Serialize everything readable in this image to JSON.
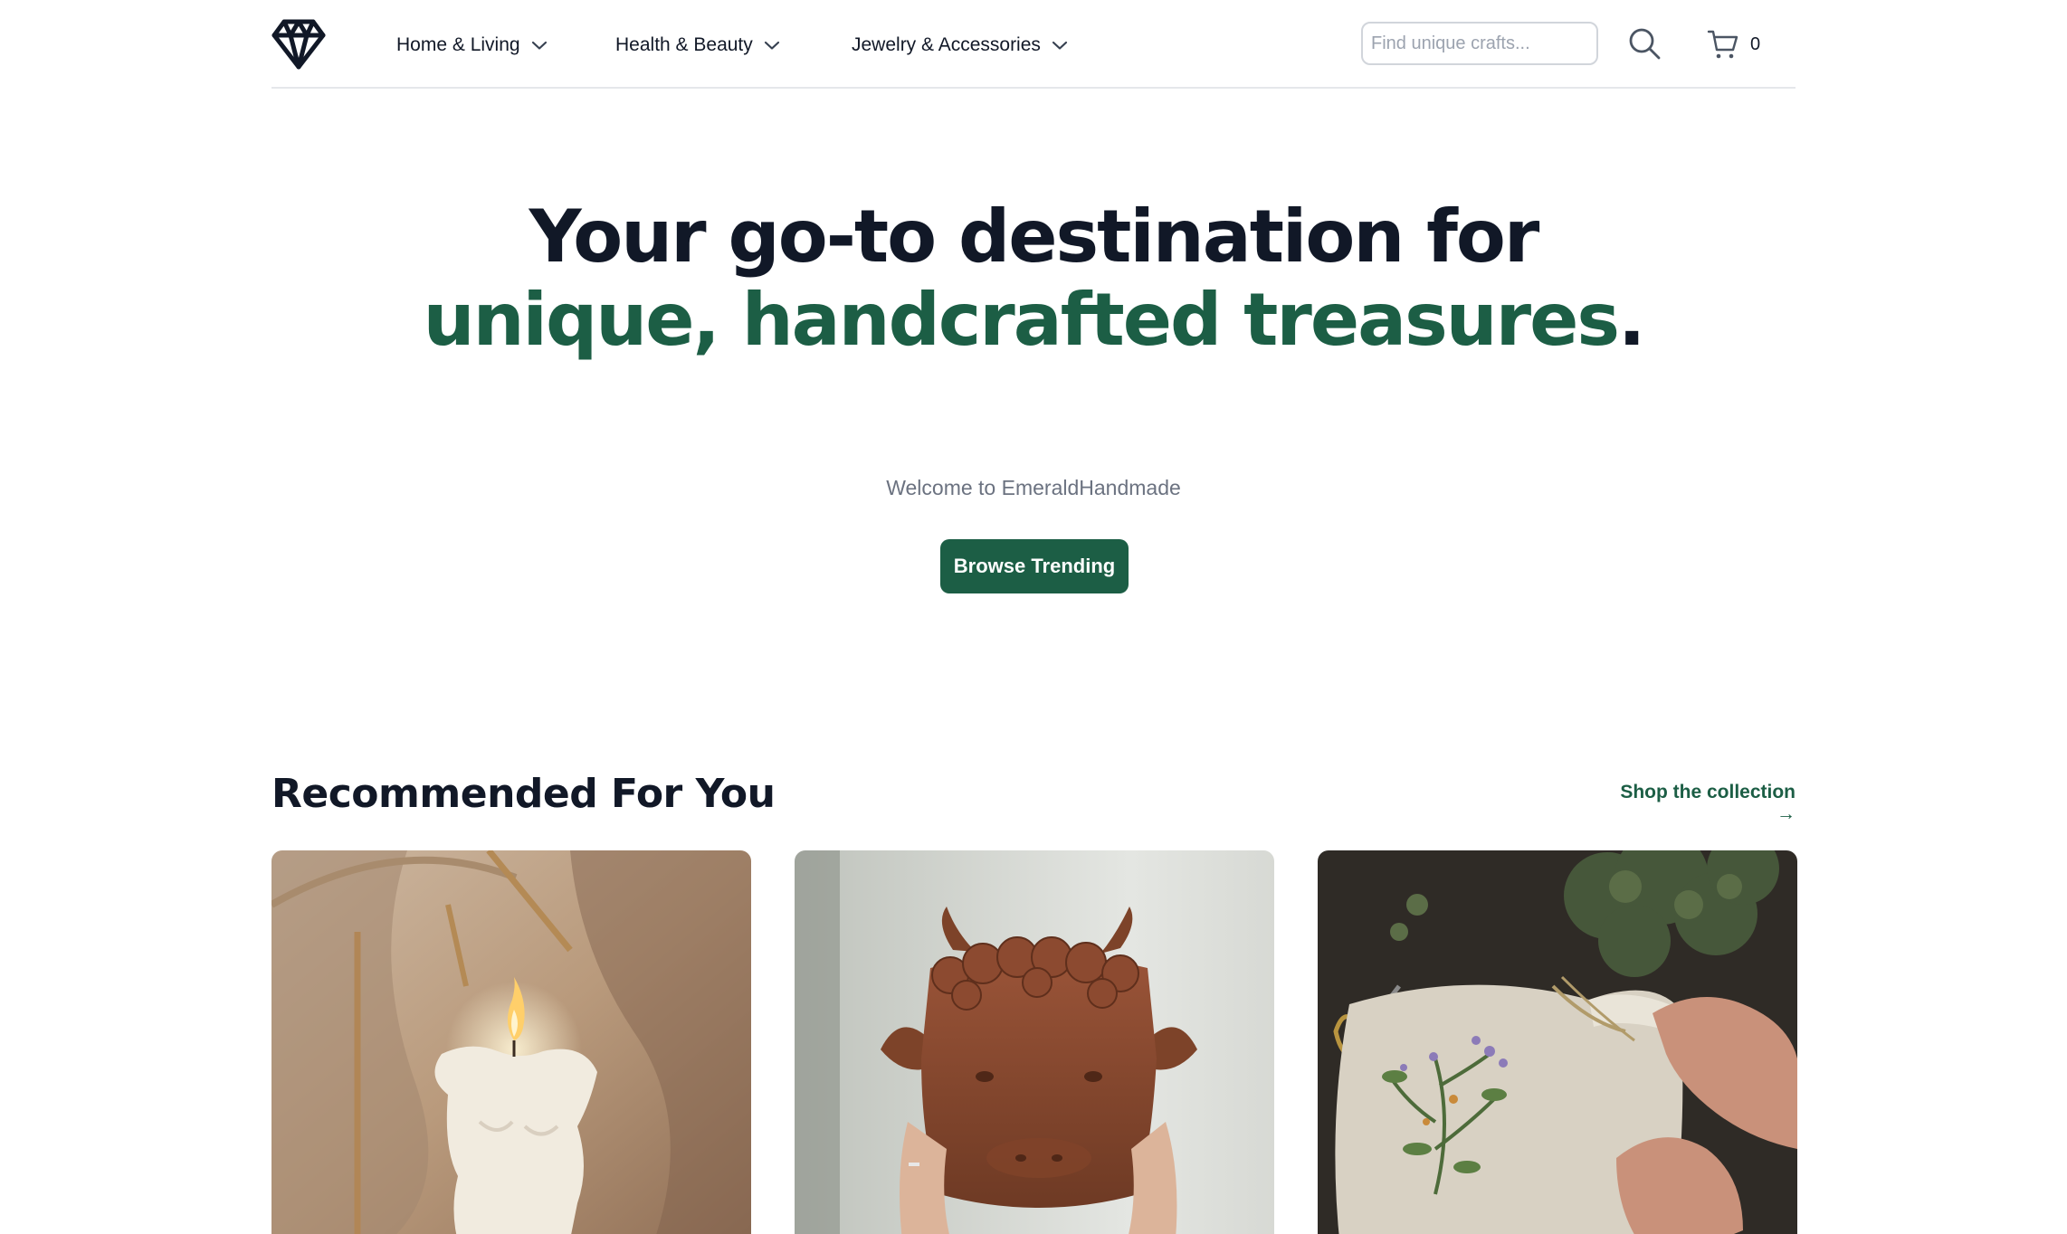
{
  "brand": {
    "logo": "diamond-icon"
  },
  "nav": {
    "items": [
      {
        "label": "Home & Living"
      },
      {
        "label": "Health & Beauty"
      },
      {
        "label": "Jewelry & Accessories"
      }
    ]
  },
  "search": {
    "placeholder": "Find unique crafts...",
    "value": ""
  },
  "cart": {
    "count": "0",
    "icon": "cart-icon"
  },
  "hero": {
    "title_line1": "Your go-to destination for",
    "title_accent": "unique, handcrafted treasures",
    "title_end": ".",
    "subtitle": "Welcome to EmeraldHandmade",
    "cta_label": "Browse Trending"
  },
  "recommended": {
    "title": "Recommended For You",
    "link_label": "Shop the collection →",
    "products": [
      {
        "image": "candle-image"
      },
      {
        "image": "ceramic-bull-planter-image"
      },
      {
        "image": "embroidered-linen-pouch-image"
      }
    ]
  },
  "colors": {
    "accent": "#1c5e45",
    "text": "#111827",
    "muted": "#6b7280",
    "border": "#e5e7eb"
  }
}
